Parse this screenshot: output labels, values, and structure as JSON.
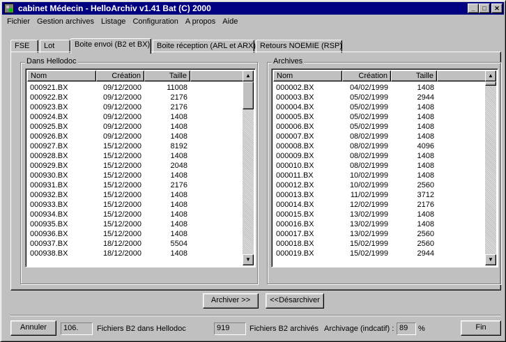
{
  "window": {
    "title": "cabinet Médecin - HelloArchiv v1.41 Bat (C) 2000"
  },
  "menu": [
    {
      "label": "Fichier"
    },
    {
      "label": "Gestion archives"
    },
    {
      "label": "Listage"
    },
    {
      "label": "Configuration"
    },
    {
      "label": "A propos"
    },
    {
      "label": "Aide"
    }
  ],
  "tabs": [
    {
      "label": "FSE"
    },
    {
      "label": "Lot"
    },
    {
      "label": "Boite envoi (B2 et BX)",
      "active": true
    },
    {
      "label": "Boite réception (ARL et ARX)"
    },
    {
      "label": "Retours NOEMIE (RSP)"
    }
  ],
  "left_panel": {
    "title": "Dans Hellodoc",
    "columns": [
      "Nom",
      "Création",
      "Taille"
    ],
    "rows": [
      [
        "000921.BX",
        "09/12/2000",
        "11008"
      ],
      [
        "000922.BX",
        "09/12/2000",
        "2176"
      ],
      [
        "000923.BX",
        "09/12/2000",
        "2176"
      ],
      [
        "000924.BX",
        "09/12/2000",
        "1408"
      ],
      [
        "000925.BX",
        "09/12/2000",
        "1408"
      ],
      [
        "000926.BX",
        "09/12/2000",
        "1408"
      ],
      [
        "000927.BX",
        "15/12/2000",
        "8192"
      ],
      [
        "000928.BX",
        "15/12/2000",
        "1408"
      ],
      [
        "000929.BX",
        "15/12/2000",
        "2048"
      ],
      [
        "000930.BX",
        "15/12/2000",
        "1408"
      ],
      [
        "000931.BX",
        "15/12/2000",
        "2176"
      ],
      [
        "000932.BX",
        "15/12/2000",
        "1408"
      ],
      [
        "000933.BX",
        "15/12/2000",
        "1408"
      ],
      [
        "000934.BX",
        "15/12/2000",
        "1408"
      ],
      [
        "000935.BX",
        "15/12/2000",
        "1408"
      ],
      [
        "000936.BX",
        "15/12/2000",
        "1408"
      ],
      [
        "000937.BX",
        "18/12/2000",
        "5504"
      ],
      [
        "000938.BX",
        "18/12/2000",
        "1408"
      ]
    ]
  },
  "right_panel": {
    "title": "Archives",
    "columns": [
      "Nom",
      "Création",
      "Taille"
    ],
    "rows": [
      [
        "000002.BX",
        "04/02/1999",
        "1408"
      ],
      [
        "000003.BX",
        "05/02/1999",
        "2944"
      ],
      [
        "000004.BX",
        "05/02/1999",
        "1408"
      ],
      [
        "000005.BX",
        "05/02/1999",
        "1408"
      ],
      [
        "000006.BX",
        "05/02/1999",
        "1408"
      ],
      [
        "000007.BX",
        "08/02/1999",
        "1408"
      ],
      [
        "000008.BX",
        "08/02/1999",
        "4096"
      ],
      [
        "000009.BX",
        "08/02/1999",
        "1408"
      ],
      [
        "000010.BX",
        "08/02/1999",
        "1408"
      ],
      [
        "000011.BX",
        "10/02/1999",
        "1408"
      ],
      [
        "000012.BX",
        "10/02/1999",
        "2560"
      ],
      [
        "000013.BX",
        "11/02/1999",
        "3712"
      ],
      [
        "000014.BX",
        "12/02/1999",
        "2176"
      ],
      [
        "000015.BX",
        "13/02/1999",
        "1408"
      ],
      [
        "000016.BX",
        "13/02/1999",
        "1408"
      ],
      [
        "000017.BX",
        "13/02/1999",
        "2560"
      ],
      [
        "000018.BX",
        "15/02/1999",
        "2560"
      ],
      [
        "000019.BX",
        "15/02/1999",
        "2944"
      ]
    ]
  },
  "actions": {
    "archive_label": "Archiver >>",
    "unarchive_label": "<<Désarchiver"
  },
  "status": {
    "cancel_label": "Annuler",
    "hellodoc_count": "106.",
    "hellodoc_label": "Fichiers B2 dans Hellodoc",
    "archived_count": "919",
    "archived_label": "Fichiers B2 archivés",
    "ratio_label": "Archivage (indcatif) :",
    "ratio_value": "89",
    "ratio_unit": "%",
    "end_label": "Fin"
  }
}
